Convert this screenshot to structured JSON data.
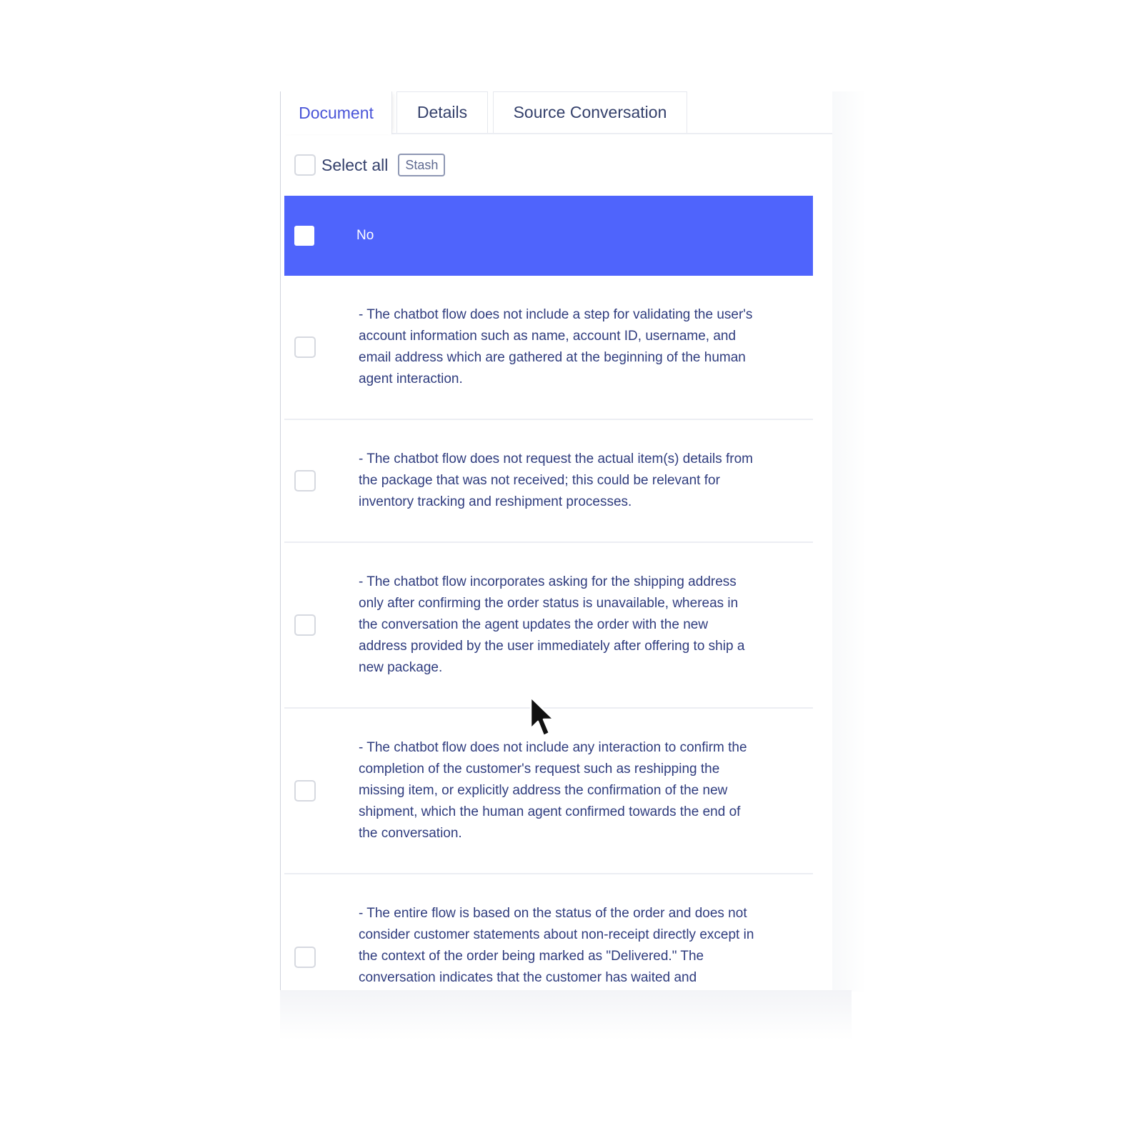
{
  "tabs": [
    {
      "label": "Document",
      "active": true
    },
    {
      "label": "Details",
      "active": false
    },
    {
      "label": "Source Conversation",
      "active": false
    }
  ],
  "toolbar": {
    "select_all_label": "Select all",
    "stash_label": "Stash"
  },
  "list": {
    "header_label": "No",
    "items": [
      {
        "text": "- The chatbot flow does not include a step for validating the user's account information such as name, account ID, username, and email address which are gathered at the beginning of the human agent interaction.",
        "checked": false
      },
      {
        "text": "- The chatbot flow does not request the actual item(s) details from the package that was not received; this could be relevant for inventory tracking and reshipment processes.",
        "checked": false
      },
      {
        "text": "- The chatbot flow incorporates asking for the shipping address only after confirming the order status is unavailable, whereas in the conversation the agent updates the order with the new address provided by the user immediately after offering to ship a new package.",
        "checked": false
      },
      {
        "text": "- The chatbot flow does not include any interaction to confirm the completion of the customer's request such as reshipping the missing item, or explicitly address the confirmation of the new shipment, which the human agent confirmed towards the end of the conversation.",
        "checked": false
      },
      {
        "text": "- The entire flow is based on the status of the order and does not consider customer statements about non-receipt directly except in the context of the order being marked as \"Delivered.\" The conversation indicates that the customer has waited and",
        "checked": false
      }
    ]
  },
  "colors": {
    "accent": "#4f64fc",
    "active_tab_text": "#4a55d8",
    "body_text": "#2f3c7e"
  },
  "icons": {
    "pointer": "mouse-pointer-icon"
  }
}
